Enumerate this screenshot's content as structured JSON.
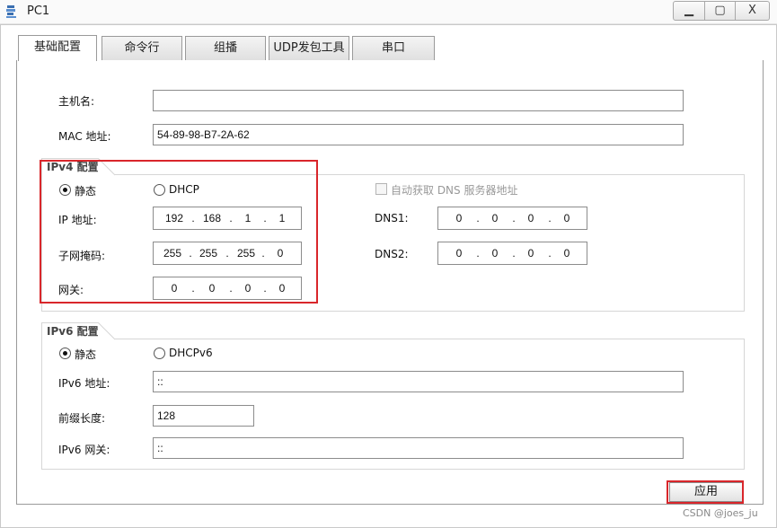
{
  "window": {
    "title": "PC1",
    "minimize_glyph": "▁",
    "maximize_glyph": "▢",
    "close_glyph": "X"
  },
  "tabs": [
    {
      "label": "基础配置",
      "active": true
    },
    {
      "label": "命令行",
      "active": false
    },
    {
      "label": "组播",
      "active": false
    },
    {
      "label": "UDP发包工具",
      "active": false
    },
    {
      "label": "串口",
      "active": false
    }
  ],
  "basic": {
    "hostname_label": "主机名:",
    "hostname_value": "",
    "mac_label": "MAC 地址:",
    "mac_value": "54-89-98-B7-2A-62"
  },
  "ipv4": {
    "group_title": "IPv4 配置",
    "static_label": "静态",
    "dhcp_label": "DHCP",
    "mode": "static",
    "auto_dns_label": "自动获取 DNS 服务器地址",
    "ip_label": "IP 地址:",
    "ip": [
      "192",
      "168",
      "1",
      "1"
    ],
    "mask_label": "子网掩码:",
    "mask": [
      "255",
      "255",
      "255",
      "0"
    ],
    "gateway_label": "网关:",
    "gateway": [
      "0",
      "0",
      "0",
      "0"
    ],
    "dns1_label": "DNS1:",
    "dns1": [
      "0",
      "0",
      "0",
      "0"
    ],
    "dns2_label": "DNS2:",
    "dns2": [
      "0",
      "0",
      "0",
      "0"
    ]
  },
  "ipv6": {
    "group_title": "IPv6 配置",
    "static_label": "静态",
    "dhcp_label": "DHCPv6",
    "mode": "static",
    "addr_label": "IPv6 地址:",
    "addr_value": "::",
    "prefix_label": "前缀长度:",
    "prefix_value": "128",
    "gateway_label": "IPv6 网关:",
    "gateway_value": "::"
  },
  "apply_label": "应用",
  "watermark": "CSDN @joes_ju",
  "colors": {
    "highlight": "#d9262b"
  }
}
